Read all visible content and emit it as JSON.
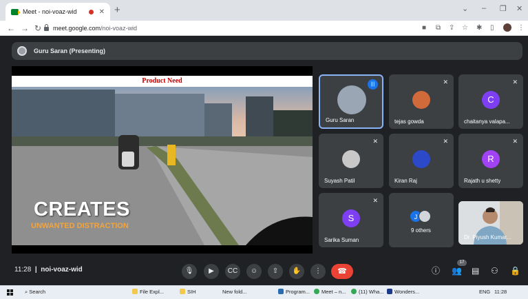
{
  "browser": {
    "tab_title": "Meet - noi-voaz-wid",
    "tab_close": "✕",
    "new_tab": "+",
    "url_host": "meet.google.com",
    "url_path": "/noi-voaz-wid"
  },
  "meet": {
    "presenter_label": "Guru Saran (Presenting)",
    "slide": {
      "heading": "Product Need",
      "line1": "CREATES",
      "line2": "UNWANTED DISTRACTION"
    },
    "tiles": [
      {
        "name": "Guru Saran",
        "kind": "photo"
      },
      {
        "name": "tejas gowda",
        "kind": "photo"
      },
      {
        "name": "chaitanya valapa...",
        "kind": "letter",
        "letter": "C",
        "color": "#7e3ff2"
      },
      {
        "name": "Suyash Patil",
        "kind": "photo"
      },
      {
        "name": "Kiran Raj",
        "kind": "photo"
      },
      {
        "name": "Rajath u shetty",
        "kind": "letter",
        "letter": "R",
        "color": "#a142f4"
      },
      {
        "name": "Sarika Suman",
        "kind": "letter",
        "letter": "S",
        "color": "#7e3ff2"
      },
      {
        "name": "9 others",
        "kind": "others",
        "letter": "J"
      },
      {
        "name": "Dr. Piyush Kumar...",
        "kind": "video"
      }
    ],
    "time": "11:28",
    "meeting_code": "noi-voaz-wid",
    "participants_count": "17"
  },
  "taskbar": {
    "search": "Search",
    "items": [
      "File Expl...",
      "SIH",
      "New fold...",
      "Program...",
      "Meet – n...",
      "(11) Wha...",
      "Wonders...",
      "ENG",
      "11:28"
    ]
  }
}
